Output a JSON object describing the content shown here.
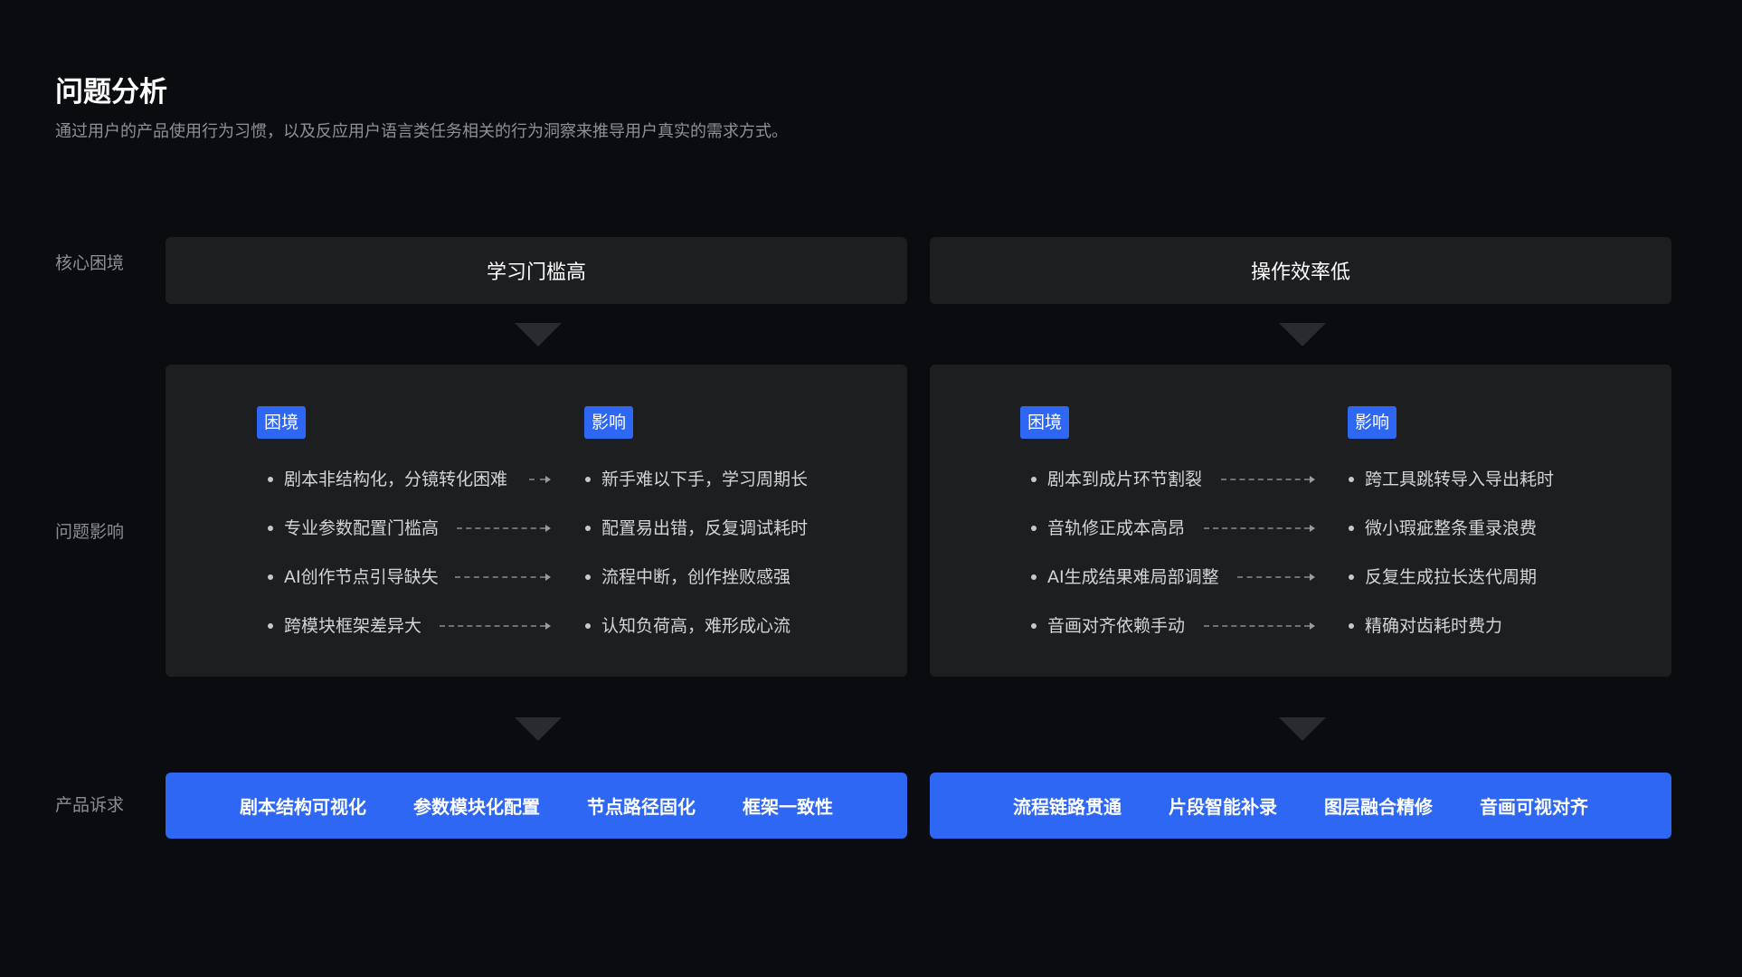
{
  "header": {
    "title": "问题分析",
    "subtitle": "通过用户的产品使用行为习惯，以及反应用户语言类任务相关的行为洞察来推导用户真实的需求方式。"
  },
  "row_labels": {
    "core": "核心困境",
    "impact": "问题影响",
    "demand": "产品诉求"
  },
  "columns": [
    {
      "core": "学习门槛高",
      "tag_left": "困境",
      "tag_right": "影响",
      "items": [
        {
          "left": "剧本非结构化，分镜转化困难",
          "right": "新手难以下手，学习周期长"
        },
        {
          "left": "专业参数配置门槛高",
          "right": "配置易出错，反复调试耗时"
        },
        {
          "left": "AI创作节点引导缺失",
          "right": "流程中断，创作挫败感强"
        },
        {
          "left": "跨模块框架差异大",
          "right": "认知负荷高，难形成心流"
        }
      ],
      "demands": [
        "剧本结构可视化",
        "参数模块化配置",
        "节点路径固化",
        "框架一致性"
      ]
    },
    {
      "core": "操作效率低",
      "tag_left": "困境",
      "tag_right": "影响",
      "items": [
        {
          "left": "剧本到成片环节割裂",
          "right": "跨工具跳转导入导出耗时"
        },
        {
          "left": "音轨修正成本高昂",
          "right": "微小瑕疵整条重录浪费"
        },
        {
          "left": "AI生成结果难局部调整",
          "right": "反复生成拉长迭代周期"
        },
        {
          "left": "音画对齐依赖手动",
          "right": "精确对齿耗时费力"
        }
      ],
      "demands": [
        "流程链路贯通",
        "片段智能补录",
        "图层融合精修",
        "音画可视对齐"
      ]
    }
  ],
  "colors": {
    "background": "#0b0c0f",
    "panel": "#1d1e20",
    "accent": "#2e67f3"
  }
}
